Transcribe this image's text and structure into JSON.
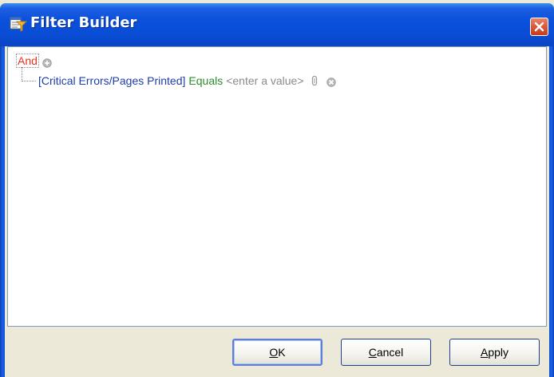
{
  "window": {
    "title": "Filter Builder"
  },
  "filter": {
    "group_operator": "And",
    "conditions": [
      {
        "field": "[Critical Errors/Pages Printed]",
        "operator": "Equals",
        "value_placeholder": "<enter a value>"
      }
    ]
  },
  "buttons": {
    "ok": {
      "mnemonic": "O",
      "rest": "K"
    },
    "cancel": {
      "mnemonic": "C",
      "rest": "ancel"
    },
    "apply": {
      "mnemonic": "A",
      "rest": "pply"
    }
  },
  "colors": {
    "group_operator": "#e8321e",
    "field": "#1d3ea8",
    "operator": "#2e8b2e",
    "placeholder": "#8a8a8a",
    "titlebar": "#0a50dc"
  },
  "icons": {
    "title": "filter-builder-icon",
    "add_condition": "plus-circle-icon",
    "value_type": "clip-icon",
    "remove_condition": "remove-circle-icon",
    "close": "close-icon"
  }
}
